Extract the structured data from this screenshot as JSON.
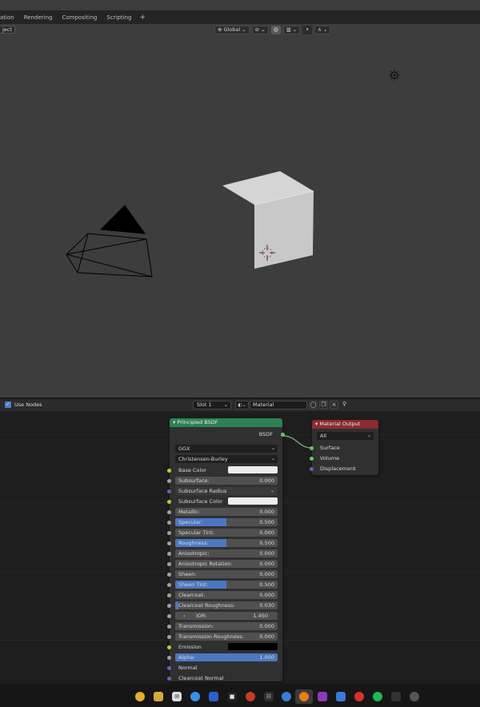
{
  "workspace_tabs": [
    "ation",
    "Rendering",
    "Compositing",
    "Scripting"
  ],
  "workspace_add": "+",
  "viewport": {
    "object_label": "ject",
    "orientation": "Global",
    "orientation_chevron": "⌄"
  },
  "node_editor": {
    "use_nodes_label": "Use Nodes",
    "use_nodes_checked": "✓",
    "slot": "Slot 1",
    "material_name": "Material"
  },
  "principled": {
    "title": "Principled BSDF",
    "output_label": "BSDF",
    "distribution": "GGX",
    "subsurface_method": "Christensen-Burley",
    "rows": {
      "base_color": "Base Color",
      "subsurface": "Subsurface:",
      "subsurface_val": "0.000",
      "subsurface_radius": "Subsurface Radius",
      "subsurface_color": "Subsurface Color",
      "metallic": "Metallic:",
      "metallic_val": "0.000",
      "specular": "Specular:",
      "specular_val": "0.500",
      "specular_frac": 0.5,
      "specular_tint": "Specular Tint:",
      "specular_tint_val": "0.000",
      "roughness": "Roughness:",
      "roughness_val": "0.500",
      "roughness_frac": 0.5,
      "anisotropic": "Anisotropic:",
      "anisotropic_val": "0.000",
      "anisotropic_rotation": "Anisotropic Rotation:",
      "anisotropic_rotation_val": "0.000",
      "sheen": "Sheen:",
      "sheen_val": "0.000",
      "sheen_tint": "Sheen Tint:",
      "sheen_tint_val": "0.500",
      "sheen_tint_frac": 0.5,
      "clearcoat": "Clearcoat:",
      "clearcoat_val": "0.000",
      "clearcoat_roughness": "Clearcoat Roughness:",
      "clearcoat_roughness_val": "0.030",
      "clearcoat_roughness_frac": 0.03,
      "ior": "IOR:",
      "ior_val": "1.450",
      "transmission": "Transmission:",
      "transmission_val": "0.000",
      "transmission_roughness": "Transmission Roughness:",
      "transmission_roughness_val": "0.000",
      "emission": "Emission",
      "alpha": "Alpha:",
      "alpha_val": "1.000",
      "alpha_frac": 1.0,
      "normal": "Normal",
      "clearcoat_normal": "Clearcoat Normal"
    }
  },
  "material_output": {
    "title": "Material Output",
    "target": "All",
    "inputs": [
      "Surface",
      "Volume",
      "Displacement"
    ]
  },
  "colors": {
    "bsdf_header": "#2c8152",
    "output_header": "#8b2a31",
    "slider_fill": "#4c77c2",
    "checkbox": "#4a7fd1"
  },
  "taskbar_icons": [
    "chrome-icon",
    "files-icon",
    "mail-icon",
    "messenger-icon",
    "bitwarden-icon",
    "stop-icon",
    "video-editor-icon",
    "signal-icon",
    "blender-icon",
    "podcast-icon",
    "teams-icon",
    "adobe-icon",
    "firefox-icon",
    "spotify-icon",
    "camera-icon",
    "settings-icon"
  ]
}
